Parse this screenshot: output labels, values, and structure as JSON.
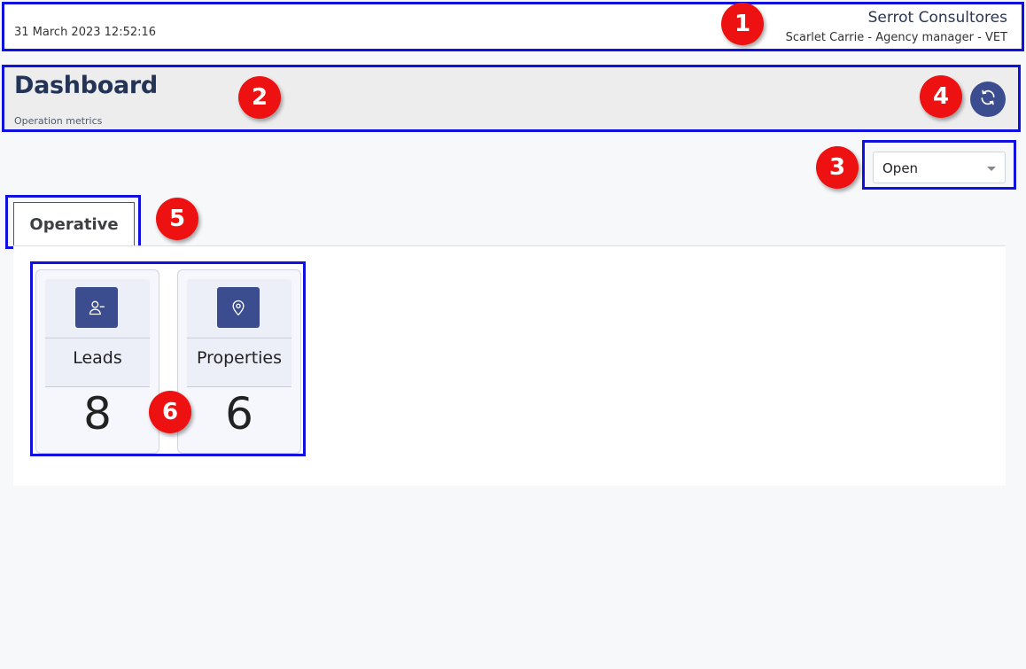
{
  "topbar": {
    "datetime": "31 March 2023 12:52:16",
    "company": "Serrot Consultores",
    "user": "Scarlet Carrie - Agency manager - VET"
  },
  "header": {
    "title": "Dashboard",
    "subtitle": "Operation metrics",
    "refresh_icon": "refresh-icon"
  },
  "status_select": {
    "value": "Open"
  },
  "tabs": [
    {
      "label": "Operative",
      "active": true
    }
  ],
  "cards": [
    {
      "label": "Leads",
      "count": "8",
      "icon": "user-minus-icon"
    },
    {
      "label": "Properties",
      "count": "6",
      "icon": "map-pin-icon"
    }
  ],
  "markers": [
    "1",
    "2",
    "3",
    "4",
    "5",
    "6"
  ],
  "colors": {
    "accent": "#3c4d8f",
    "title": "#233457",
    "highlight_border": "#1010e0",
    "marker": "#ee1111"
  }
}
